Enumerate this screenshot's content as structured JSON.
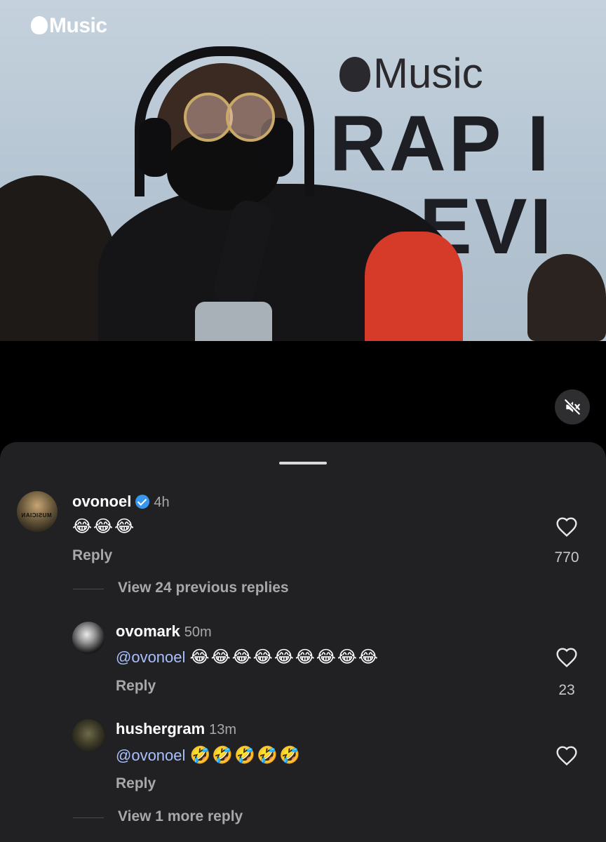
{
  "video": {
    "watermark": "Music",
    "bg_brand": "Music",
    "bg_text_1": "RAP I",
    "bg_text_2": "EVI",
    "mic_brand": "Music",
    "mute_icon": "muted-speaker-icon"
  },
  "comments": [
    {
      "username": "ovonoel",
      "verified": true,
      "time": "4h",
      "text_emoji": "😂😂😂",
      "reply_label": "Reply",
      "likes": "770",
      "avatar_text": "MUSICIAN"
    },
    {
      "username": "ovomark",
      "time": "50m",
      "mention": "@ovonoel",
      "text_emoji": "😂😂😂😂😂😂😂😂😂",
      "reply_label": "Reply",
      "likes": "23"
    },
    {
      "username": "hushergram",
      "time": "13m",
      "mention": "@ovonoel",
      "text_emoji": "🤣🤣🤣🤣🤣",
      "reply_label": "Reply",
      "likes": ""
    }
  ],
  "view_previous": "View 24 previous replies",
  "view_more": "View 1 more reply",
  "colors": {
    "sheet_bg": "#212124",
    "verified_blue": "#3797f0",
    "mention": "#a9c0ff"
  }
}
